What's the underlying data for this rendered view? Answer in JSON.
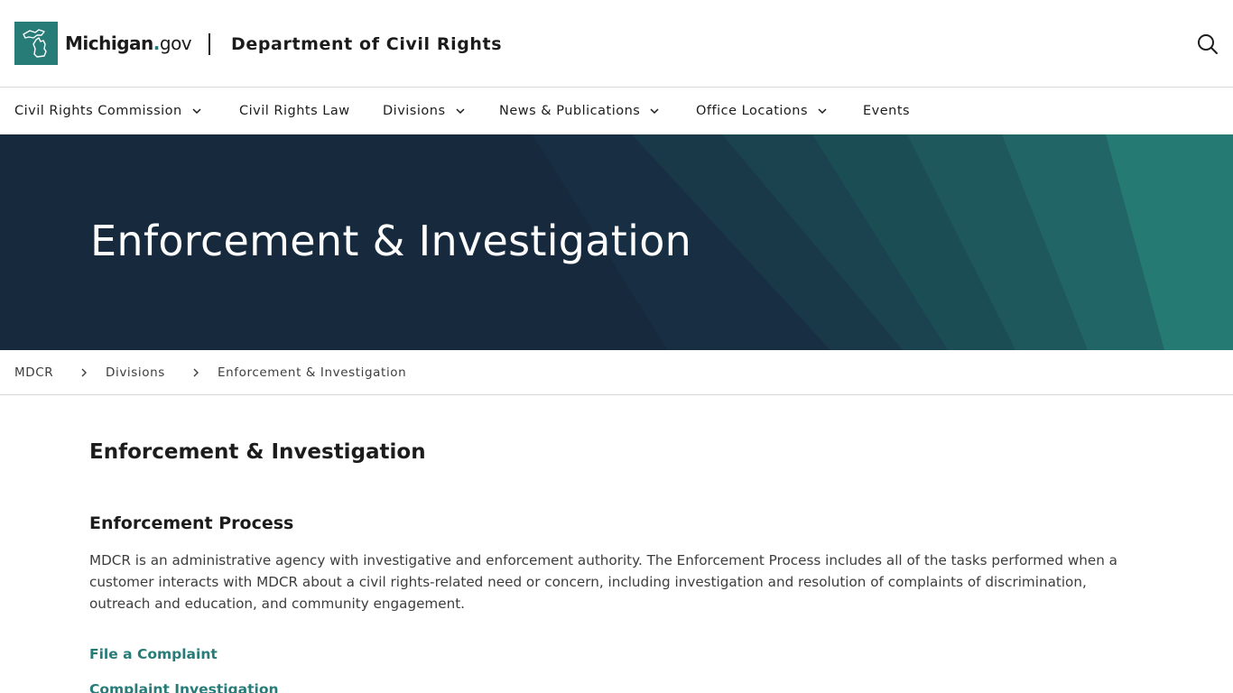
{
  "header": {
    "logo_name": "Michigan",
    "logo_dot": ".",
    "logo_suffix": "gov",
    "department": "Department of Civil Rights",
    "logo_icon": "michigan-map-icon",
    "search_icon": "search-icon"
  },
  "nav": {
    "items": [
      {
        "label": "Civil Rights Commission",
        "has_dropdown": true
      },
      {
        "label": "Civil Rights Law",
        "has_dropdown": false
      },
      {
        "label": "Divisions",
        "has_dropdown": true
      },
      {
        "label": "News & Publications",
        "has_dropdown": true
      },
      {
        "label": "Office Locations",
        "has_dropdown": true
      },
      {
        "label": "Events",
        "has_dropdown": false
      }
    ]
  },
  "hero": {
    "title": "Enforcement & Investigation"
  },
  "breadcrumb": {
    "items": [
      "MDCR",
      "Divisions",
      "Enforcement & Investigation"
    ]
  },
  "content": {
    "page_heading": "Enforcement & Investigation",
    "section_heading": "Enforcement Process",
    "paragraph": "MDCR is an administrative agency with investigative and enforcement authority. The Enforcement Process includes all of the tasks performed when a customer interacts with MDCR about a civil rights-related need or concern, including investigation and resolution of complaints of discrimination, outreach and education, and community engagement.",
    "links": [
      "File a Complaint",
      "Complaint Investigation"
    ]
  },
  "colors": {
    "brand_teal": "#277c78",
    "hero_navy": "#172a3d",
    "text": "#1c1c1c"
  }
}
